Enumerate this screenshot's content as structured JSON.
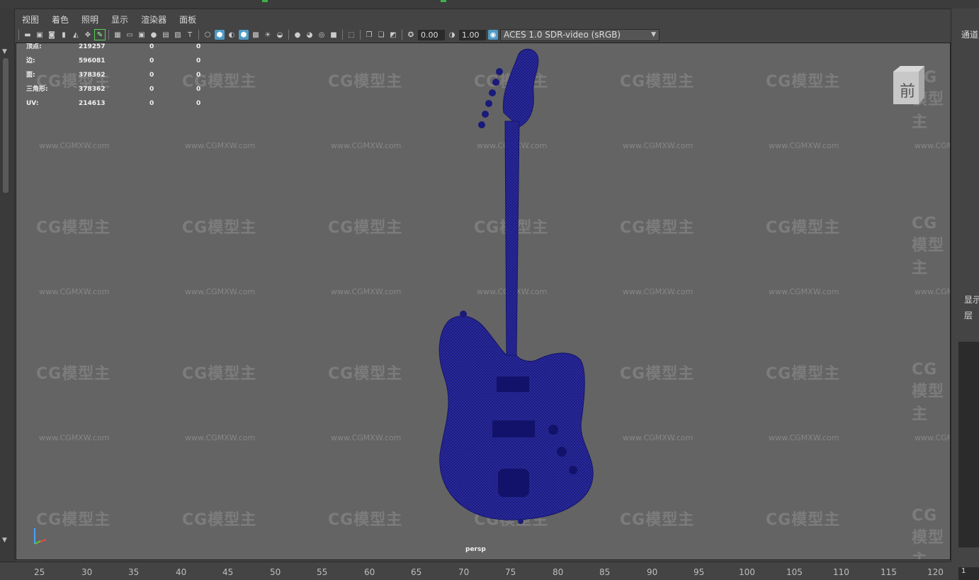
{
  "menu": [
    "视图",
    "着色",
    "照明",
    "显示",
    "渲染器",
    "面板"
  ],
  "toolbar": {
    "exposure": "0.00",
    "gamma": "1.00",
    "color_space": "ACES 1.0 SDR-video (sRGB)"
  },
  "hud": {
    "rows": [
      {
        "label": "顶点:",
        "v1": "219257",
        "v2": "0",
        "v3": "0"
      },
      {
        "label": "边:",
        "v1": "596081",
        "v2": "0",
        "v3": "0"
      },
      {
        "label": "面:",
        "v1": "378362",
        "v2": "0",
        "v3": "0"
      },
      {
        "label": "三角形:",
        "v1": "378362",
        "v2": "0",
        "v3": "0"
      },
      {
        "label": "UV:",
        "v1": "214613",
        "v2": "0",
        "v3": "0"
      }
    ]
  },
  "viewcube_label": "前",
  "camera_label": "persp",
  "watermark": {
    "logo": "CG模型主",
    "url": "www.CGMXW.com"
  },
  "right_panel": {
    "channel_tab": "通道",
    "display_tab": "显示",
    "layer_label": "层",
    "frame_field": "1"
  },
  "timeline": {
    "ticks": [
      "25",
      "30",
      "35",
      "40",
      "45",
      "50",
      "55",
      "60",
      "65",
      "70",
      "75",
      "80",
      "85",
      "90",
      "95",
      "100",
      "105",
      "110",
      "115",
      "120"
    ]
  },
  "colors": {
    "mesh": "#1a1a8c",
    "viewport_bg": "#646464",
    "accent": "#4f9ac4"
  }
}
